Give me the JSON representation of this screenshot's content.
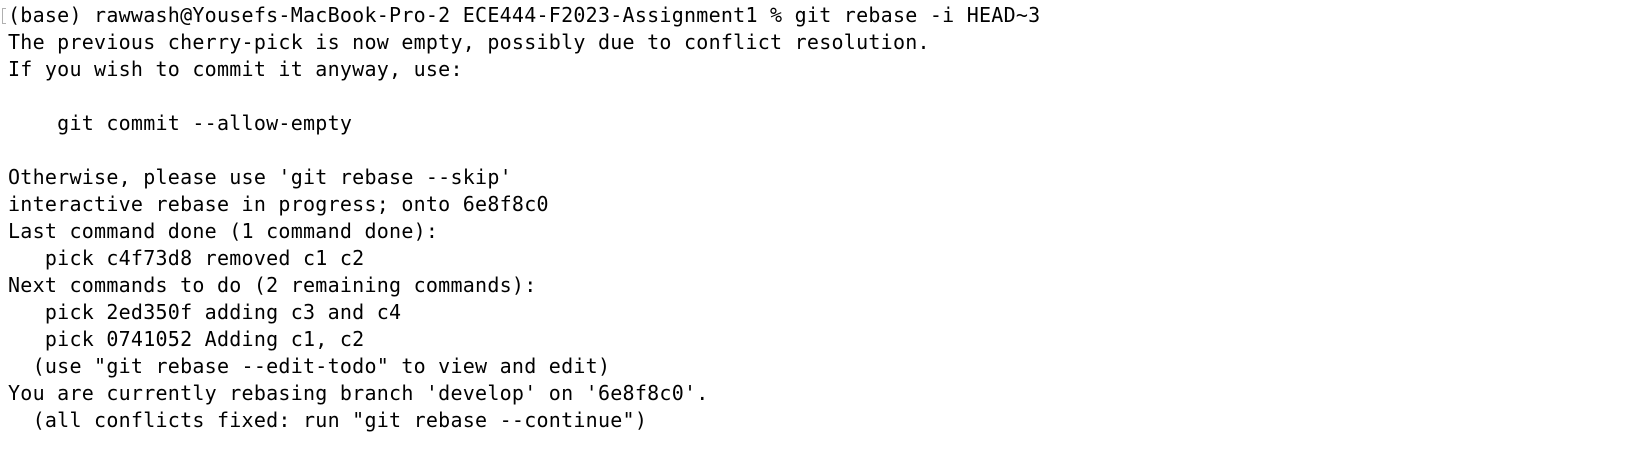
{
  "terminal": {
    "lines": [
      "(base) rawwash@Yousefs-MacBook-Pro-2 ECE444-F2023-Assignment1 % git rebase -i HEAD~3",
      "The previous cherry-pick is now empty, possibly due to conflict resolution.",
      "If you wish to commit it anyway, use:",
      "",
      "    git commit --allow-empty",
      "",
      "Otherwise, please use 'git rebase --skip'",
      "interactive rebase in progress; onto 6e8f8c0",
      "Last command done (1 command done):",
      "   pick c4f73d8 removed c1 c2",
      "Next commands to do (2 remaining commands):",
      "   pick 2ed350f adding c3 and c4",
      "   pick 0741052 Adding c1, c2",
      "  (use \"git rebase --edit-todo\" to view and edit)",
      "You are currently rebasing branch 'develop' on '6e8f8c0'.",
      "  (all conflicts fixed: run \"git rebase --continue\")"
    ]
  }
}
